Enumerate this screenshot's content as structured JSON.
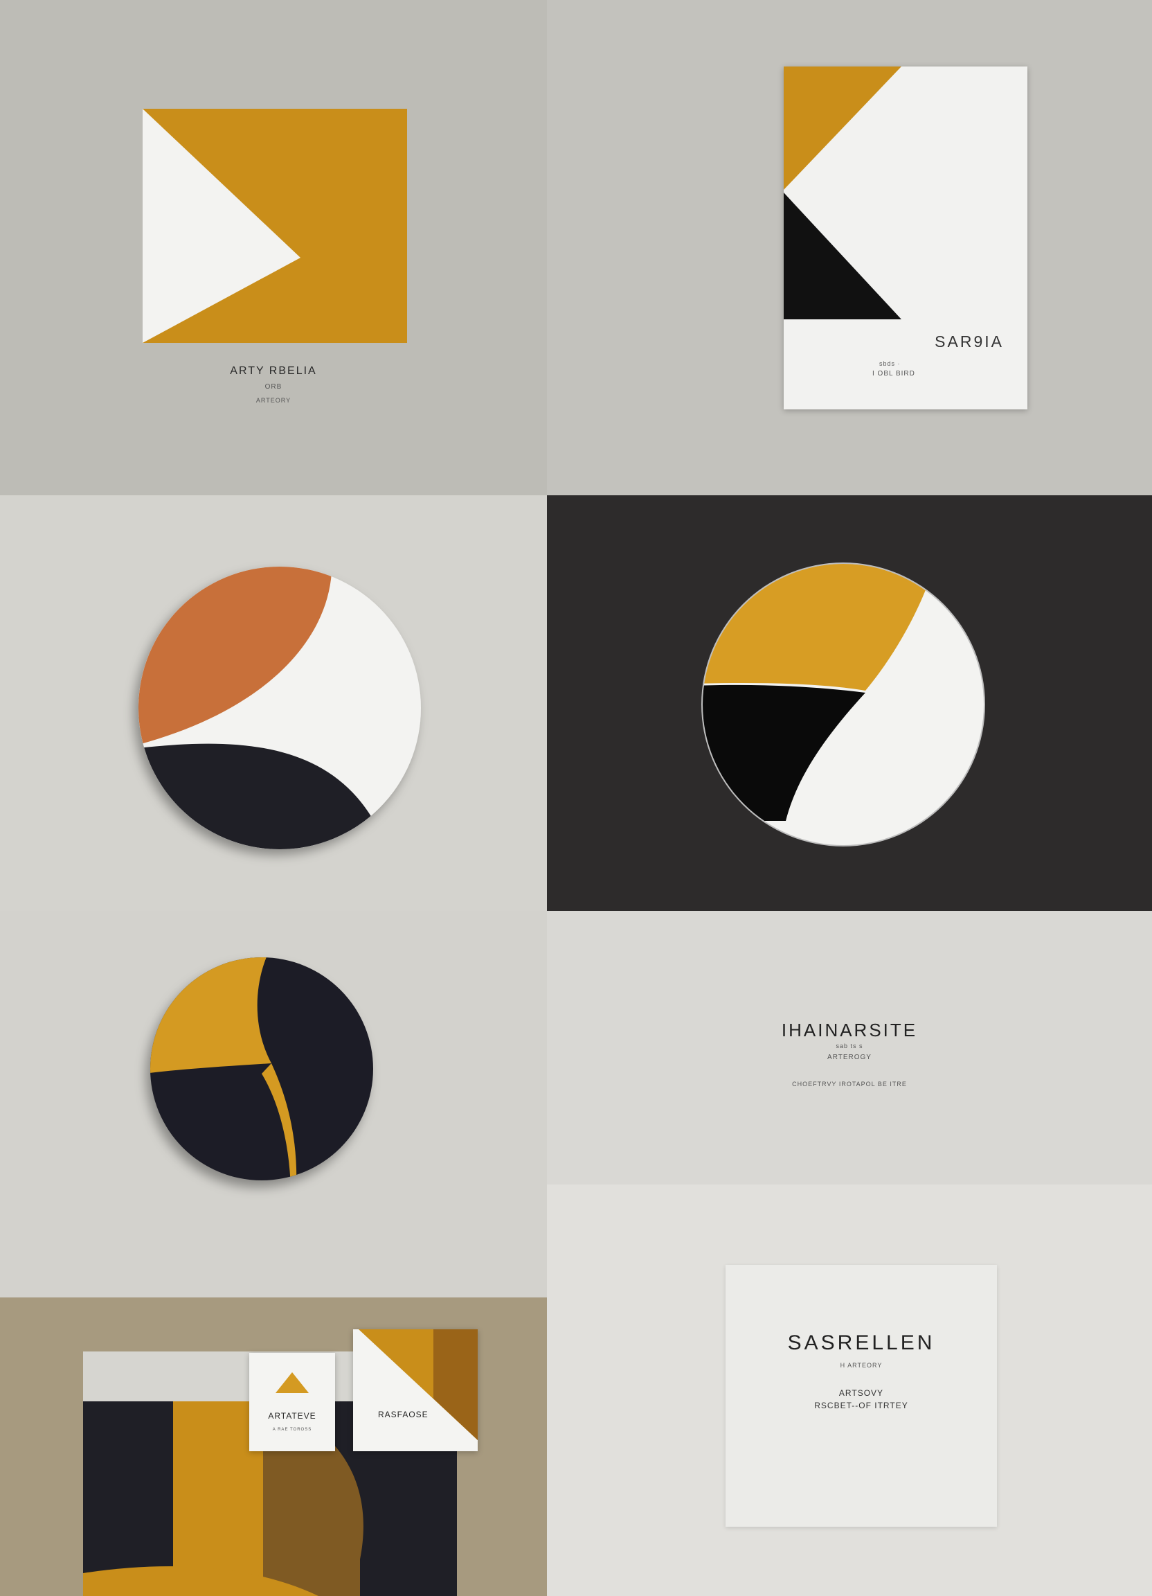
{
  "colors": {
    "gold": "#c98e1a",
    "gold_light": "#dba12a",
    "orange": "#c8703a",
    "dark": "#1f1f26",
    "black": "#2d2b2b",
    "white": "#f3f3f1",
    "gray_bg": "#bdbcb6",
    "light_bg": "#d6d5d0",
    "tan_bg": "#a79a7f"
  },
  "panels": {
    "p1": {
      "line1": "ARTY RBELIA",
      "line2": "ORB",
      "line3": "ARTEORY"
    },
    "p2": {
      "title": "SAR9IA",
      "line2": "sbds ·",
      "line3": "I OBL BIRD"
    },
    "p3": {},
    "p4": {},
    "p5": {},
    "p6": {
      "title": "IHAINARSITE",
      "line2": "sab ts s",
      "line3": "ARTEROGY",
      "line4": "CHOEFTRVY IROTAPOL BE ITRE"
    },
    "p7": {
      "card_b_text": "ARTATEVE",
      "card_b_small": "A RAE TOROSS",
      "card_c_text": "RASFAOSE"
    },
    "p8": {
      "title": "SASRELLEN",
      "line2": "H ARTEORY",
      "line3": "ARTSOVY",
      "line4": "RSCBET--OF ITRTEY"
    }
  }
}
